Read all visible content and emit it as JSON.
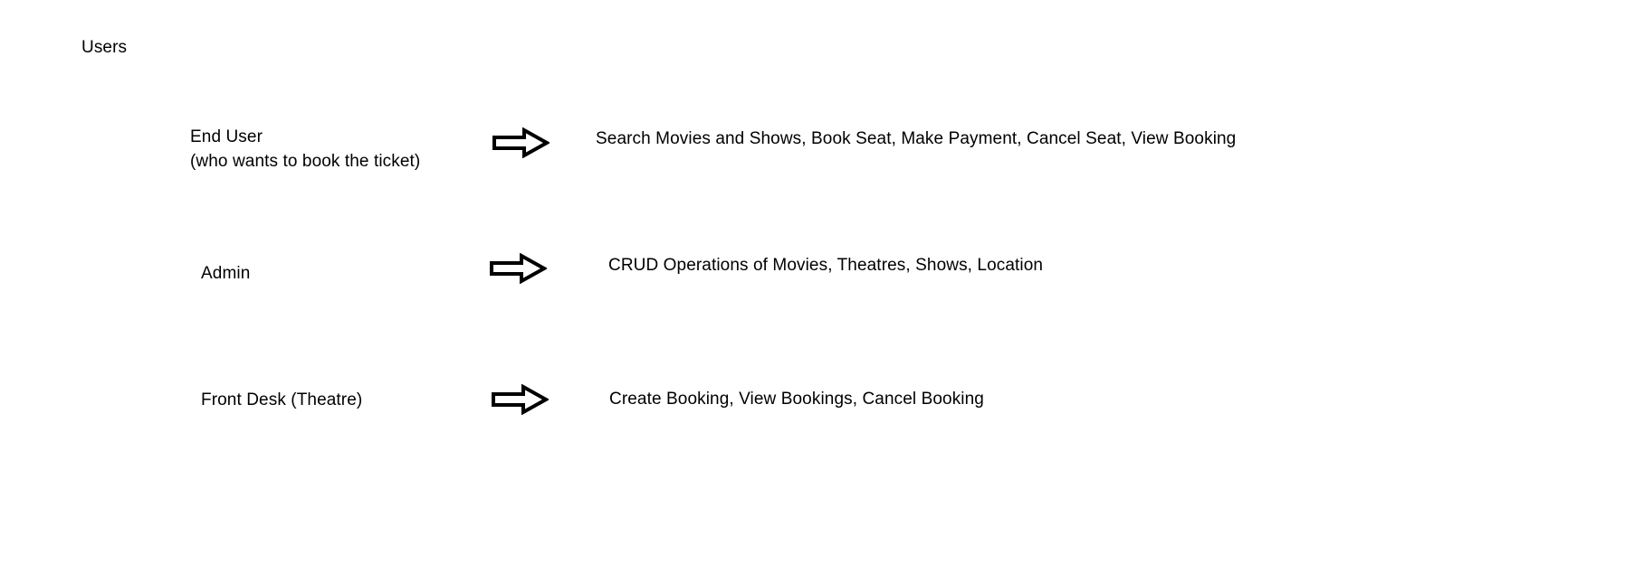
{
  "title": "Users",
  "rows": [
    {
      "actor": "End User",
      "actor_note": "(who wants to book the ticket)",
      "arrow_icon": "right-arrow-icon",
      "actions": "Search Movies and Shows, Book Seat, Make Payment, Cancel Seat, View Booking"
    },
    {
      "actor": "Admin",
      "arrow_icon": "right-arrow-icon",
      "actions": "CRUD Operations of Movies, Theatres, Shows, Location"
    },
    {
      "actor": "Front Desk (Theatre)",
      "arrow_icon": "right-arrow-icon",
      "actions": "Create Booking, View Bookings, Cancel Booking"
    }
  ],
  "colors": {
    "background": "#ffffff",
    "text": "#000000",
    "arrow_stroke": "#000000"
  }
}
